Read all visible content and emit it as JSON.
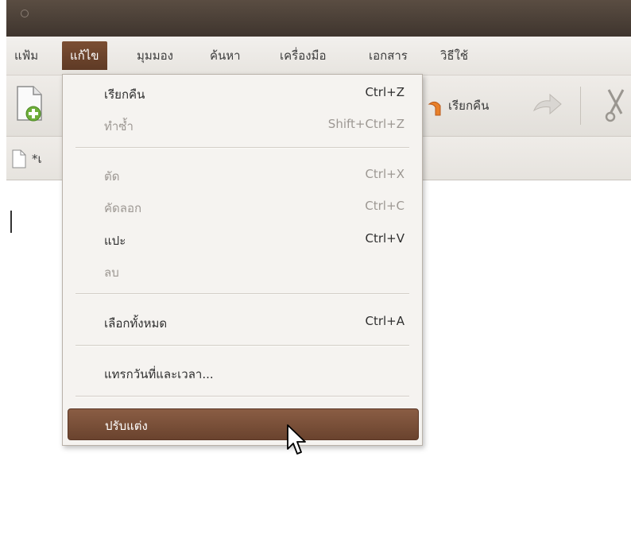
{
  "menubar": {
    "items": [
      "แฟ้ม",
      "แก้ไข",
      "มุมมอง",
      "ค้นหา",
      "เครื่องมือ",
      "เอกสาร",
      "วิธีใช้"
    ]
  },
  "toolbar": {
    "undo_label": "เรียกคืน"
  },
  "tab": {
    "label": "*เ"
  },
  "edit_menu": {
    "items": [
      {
        "label": "เรียกคืน",
        "accel": "Ctrl+Z"
      },
      {
        "label": "ทำซ้ำ",
        "accel": "Shift+Ctrl+Z"
      },
      {
        "label": "ตัด",
        "accel": "Ctrl+X"
      },
      {
        "label": "คัดลอก",
        "accel": "Ctrl+C"
      },
      {
        "label": "แปะ",
        "accel": "Ctrl+V"
      },
      {
        "label": "ลบ",
        "accel": ""
      },
      {
        "label": "เลือกทั้งหมด",
        "accel": "Ctrl+A"
      },
      {
        "label": "แทรกวันที่และเวลา...",
        "accel": ""
      },
      {
        "label": "ปรับแต่ง",
        "accel": ""
      }
    ]
  },
  "colors": {
    "titlebar": "#3f352e",
    "accent": "#7b4e33",
    "menu_bg": "#f5f3f0",
    "disabled_text": "#9d9893"
  },
  "icons": [
    "new-document-icon",
    "undo-icon",
    "redo-icon",
    "cut-icon",
    "document-icon",
    "mouse-pointer-icon"
  ]
}
